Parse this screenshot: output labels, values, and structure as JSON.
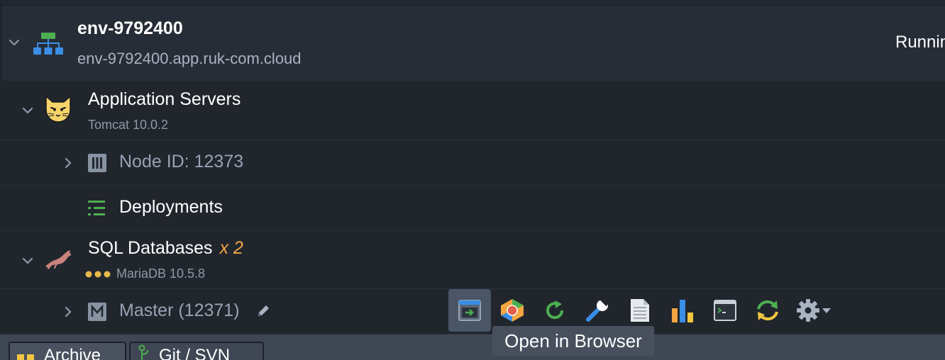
{
  "environment": {
    "name": "env-9792400",
    "domain": "env-9792400.app.ruk-com.cloud",
    "status": "Runnin"
  },
  "groups": {
    "app_servers": {
      "title": "Application Servers",
      "subtitle": "Tomcat 10.0.2",
      "node_label": "Node ID: 12373",
      "deployments_label": "Deployments"
    },
    "sql_databases": {
      "title": "SQL Databases",
      "multiplier": "x 2",
      "subtitle": "MariaDB 10.5.8",
      "node_label": "Master (12371)"
    }
  },
  "toolbar": {
    "icons": [
      "open-in-browser-icon",
      "add-ons-icon",
      "restart-icon",
      "config-icon",
      "log-icon",
      "statistics-icon",
      "web-ssh-icon",
      "redeploy-icon",
      "settings-icon"
    ],
    "tooltip": "Open in Browser"
  },
  "bottom_tabs": {
    "archive": "Archive",
    "git": "Git / SVN"
  },
  "colors": {
    "accent_orange": "#f2a541",
    "active_button": "#4a5566",
    "env_icon_green": "#4caf50",
    "env_icon_blue": "#3a8ee6"
  }
}
